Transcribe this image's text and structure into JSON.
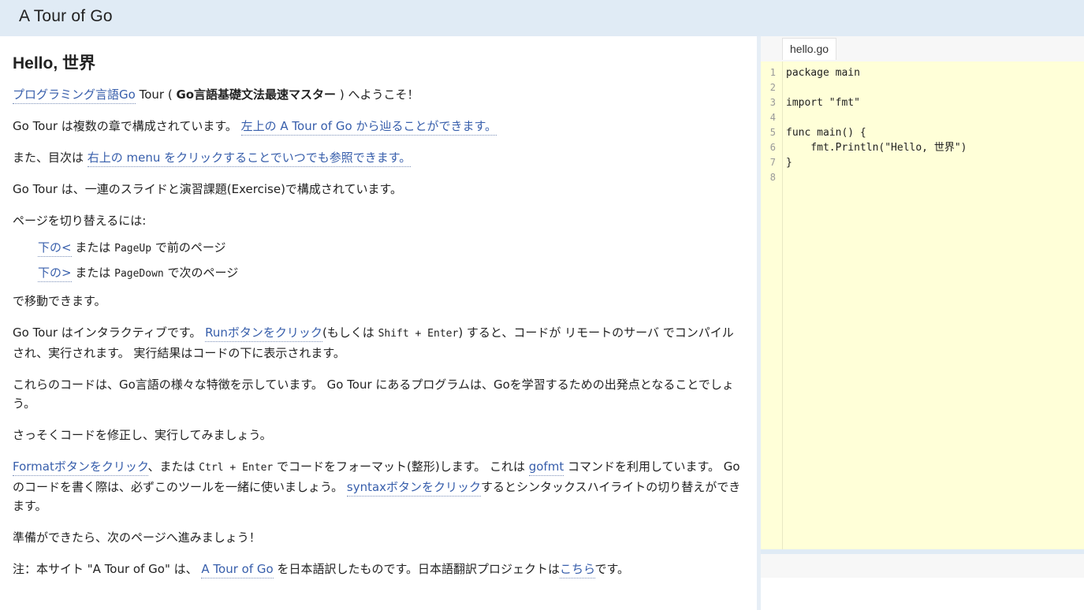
{
  "header": {
    "title": "A Tour of Go"
  },
  "content": {
    "heading": "Hello, 世界",
    "p1": {
      "link": "プログラミング言語Go",
      "t1": " Tour ( ",
      "bold": "Go言語基礎文法最速マスター",
      "t2": " ) へようこそ！"
    },
    "p2": {
      "t1": "Go Tour は複数の章で構成されています。 ",
      "link": "左上の A Tour of Go から辿ることができます。"
    },
    "p3": {
      "t1": "また、目次は ",
      "link": "右上の menu をクリックすることでいつでも参照できます。"
    },
    "p4": "Go Tour は、一連のスライドと演習課題(Exercise)で構成されています。",
    "p5": "ページを切り替えるには:",
    "nav": [
      {
        "link": "下の<",
        "t1": " または ",
        "code": "PageUp",
        "t2": " で前のページ"
      },
      {
        "link": "下の>",
        "t1": " または ",
        "code": "PageDown",
        "t2": " で次のページ"
      }
    ],
    "p6": "で移動できます。",
    "p7": {
      "t1": "Go Tour はインタラクティブです。 ",
      "link": "Runボタンをクリック",
      "t2": "(もしくは ",
      "code": "Shift + Enter",
      "t3": ") すると、コードが リモートのサーバ でコンパイルされ、実行されます。 実行結果はコードの下に表示されます。"
    },
    "p8": "これらのコードは、Go言語の様々な特徴を示しています。 Go Tour にあるプログラムは、Goを学習するための出発点となることでしょう。",
    "p9": "さっそくコードを修正し、実行してみましょう。",
    "p10": {
      "link": "Formatボタンをクリック",
      "t1": "、または ",
      "code": "Ctrl + Enter",
      "t2": " でコードをフォーマット(整形)します。 これは ",
      "link2": "gofmt",
      "t3": " コマンドを利用しています。 Goのコードを書く際は、必ずこのツールを一緒に使いましょう。 ",
      "link3": "syntaxボタンをクリック",
      "t4": "するとシンタックスハイライトの切り替えができます。"
    },
    "p11": "準備ができたら、次のページへ進みましょう！",
    "p12": {
      "t1": "注：本サイト \"A Tour of Go\" は、 ",
      "link": "A Tour of Go",
      "t2": " を日本語訳したものです。日本語翻訳プロジェクトは",
      "link2": "こちら",
      "t3": "です。"
    }
  },
  "editor": {
    "filename": "hello.go",
    "line_numbers": [
      "1",
      "2",
      "3",
      "4",
      "5",
      "6",
      "7",
      "8"
    ],
    "lines": [
      "package main",
      "",
      "import \"fmt\"",
      "",
      "func main() {",
      "    fmt.Println(\"Hello, 世界\")",
      "}",
      ""
    ]
  }
}
